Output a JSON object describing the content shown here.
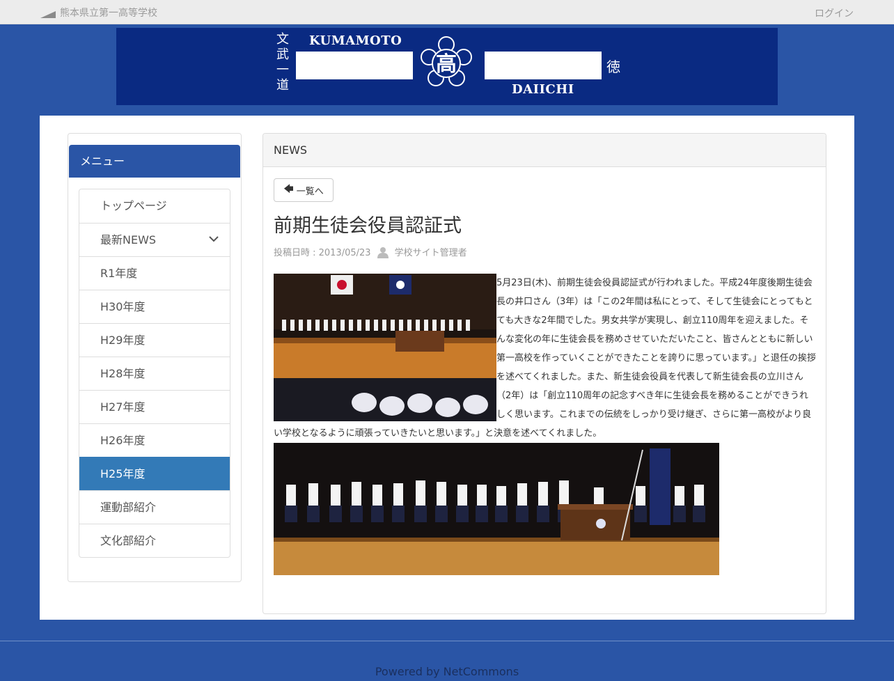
{
  "topbar": {
    "site_name": "熊本県立第一高等学校",
    "login_label": "ログイン"
  },
  "banner": {
    "word_left": "KUMAMOTO",
    "word_right": "DAIICHI",
    "emblem_char": "高",
    "vertical_left": "文武一道",
    "vertical_right": "徳"
  },
  "sidebar": {
    "header": "メニュー",
    "items": [
      {
        "label": "トップページ"
      },
      {
        "label": "最新NEWS"
      },
      {
        "label": "R1年度"
      },
      {
        "label": "H30年度"
      },
      {
        "label": "H29年度"
      },
      {
        "label": "H28年度"
      },
      {
        "label": "H27年度"
      },
      {
        "label": "H26年度"
      },
      {
        "label": "H25年度"
      },
      {
        "label": "運動部紹介"
      },
      {
        "label": "文化部紹介"
      }
    ],
    "active_item": "H25年度"
  },
  "news": {
    "panel_title": "NEWS",
    "back_label": "一覧へ",
    "title": "前期生徒会役員認証式",
    "posted_label": "投稿日時 : 2013/05/23",
    "author": "学校サイト管理者",
    "body": "5月23日(木)、前期生徒会役員認証式が行われました。平成24年度後期生徒会長の井口さん（3年）は「この2年間は私にとって、そして生徒会にとってもとても大きな2年間でした。男女共学が実現し、創立110周年を迎えました。そんな変化の年に生徒会長を務めさせていただいたこと、皆さんとともに新しい第一高校を作っていくことができたことを誇りに思っています。」と退任の挨拶を述べてくれました。また、新生徒会役員を代表して新生徒会長の立川さん（2年）は「創立110周年の記念すべき年に生徒会長を務めることができうれしく思います。これまでの伝統をしっかり受け継ぎ、さらに第一高校がより良い学校となるように頑張っていきたいと思います。」と決意を述べてくれました。"
  },
  "footer": {
    "powered_by": "Powered by NetCommons"
  },
  "colors": {
    "brand_blue": "#2a55a6",
    "active_item": "#337ab7",
    "banner_navy": "#0a2a82"
  }
}
